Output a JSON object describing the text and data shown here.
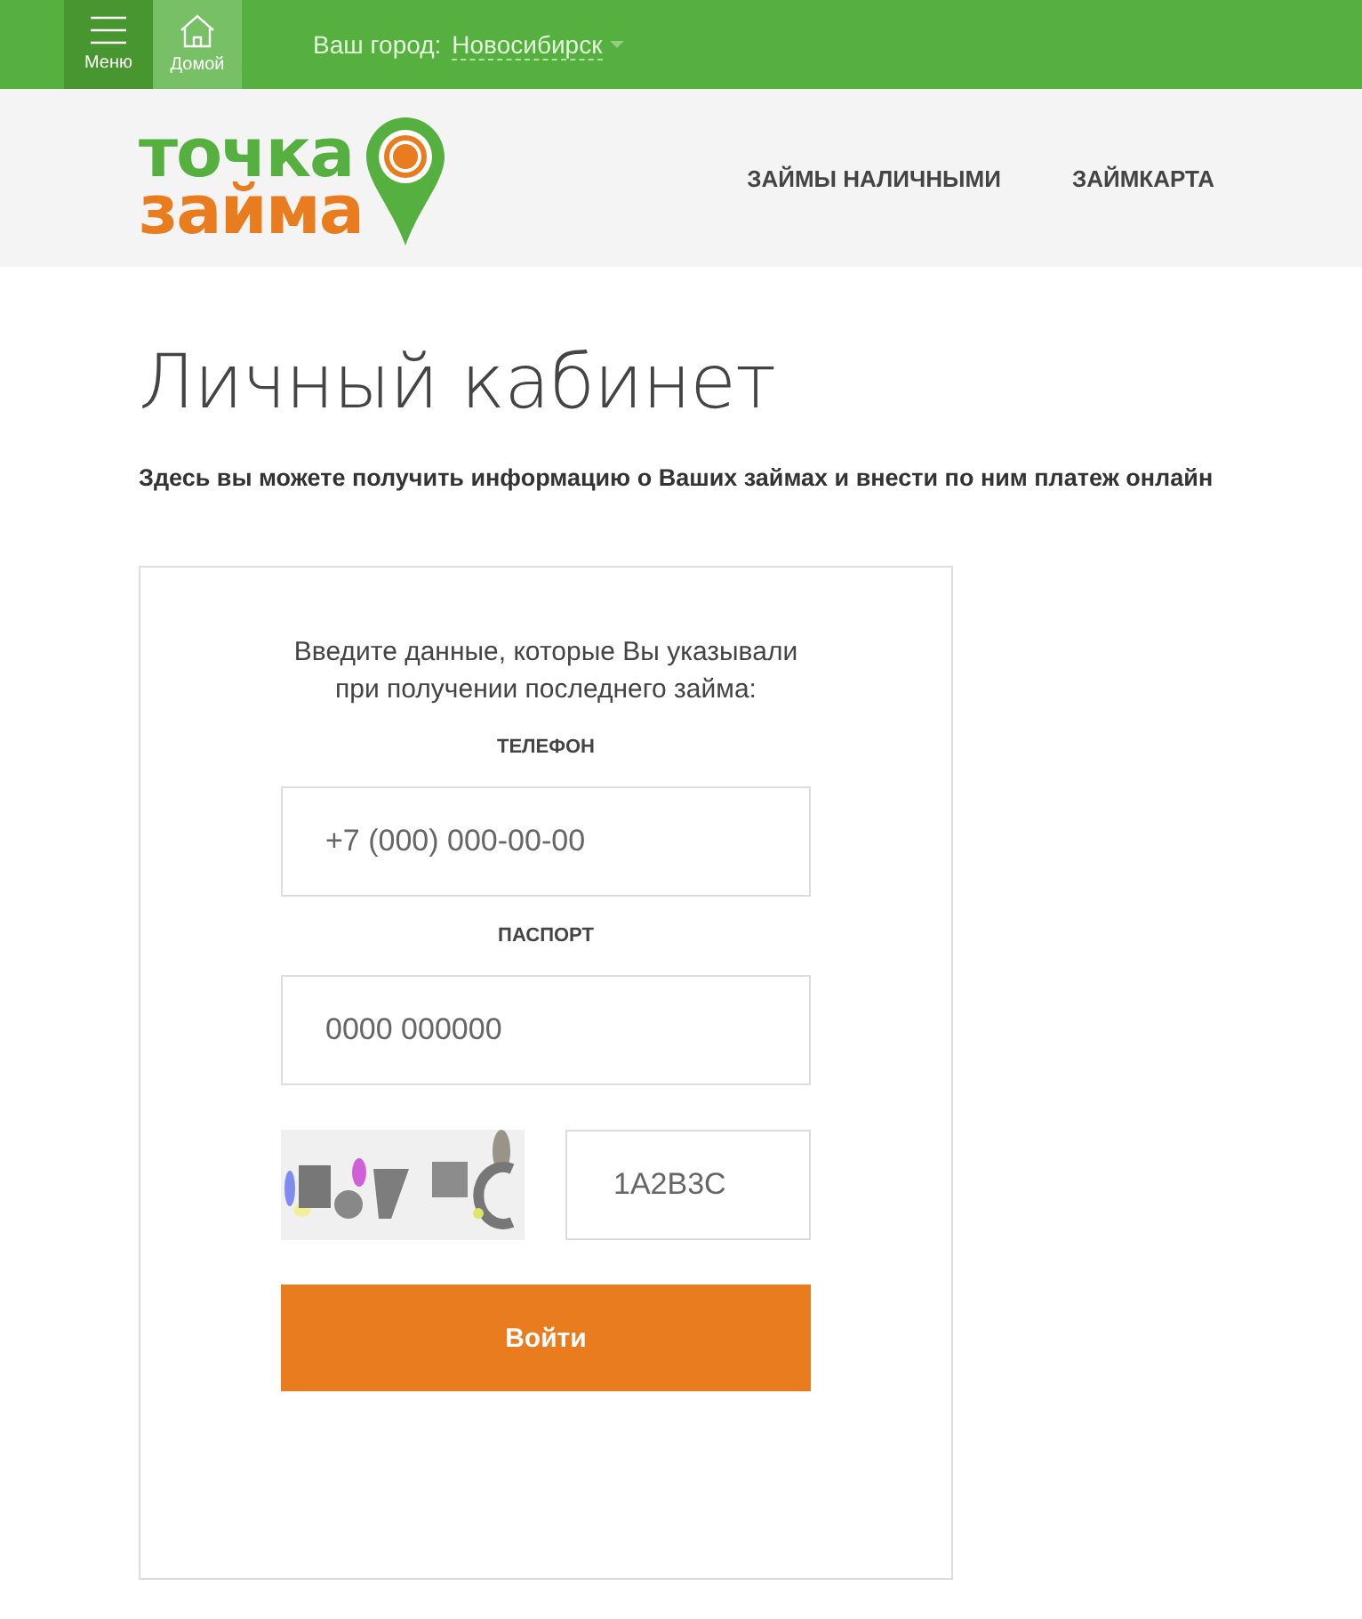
{
  "top_bar": {
    "buttons": [
      {
        "kind": "menu",
        "label": "Меню",
        "selected": true
      },
      {
        "kind": "home",
        "label": "Домой",
        "selected": false
      }
    ],
    "city_label": "Ваш город:",
    "city": "Новосибирск"
  },
  "header": {
    "logo": {
      "line_1": "точка",
      "line_2": "займа"
    },
    "nav": [
      "ЗАЙМЫ НАЛИЧНЫМИ",
      "ЗАЙМКАРТА"
    ]
  },
  "page": {
    "title": "Личный кабинет",
    "subtitle": "Здесь вы можете получить информацию о Ваших займах и внести по ним платеж онлайн"
  },
  "form": {
    "intro": "Введите данные, которые Вы указывали при получении последнего займа:",
    "fields": [
      {
        "label": "ТЕЛЕФОН",
        "placeholder": "+7 (000) 000-00-00"
      },
      {
        "label": "ПАСПОРТ",
        "placeholder": "0000 000000"
      }
    ],
    "captcha": {
      "kind": "picture",
      "placeholder": "1A2B3C"
    },
    "submit": "Войти"
  }
}
